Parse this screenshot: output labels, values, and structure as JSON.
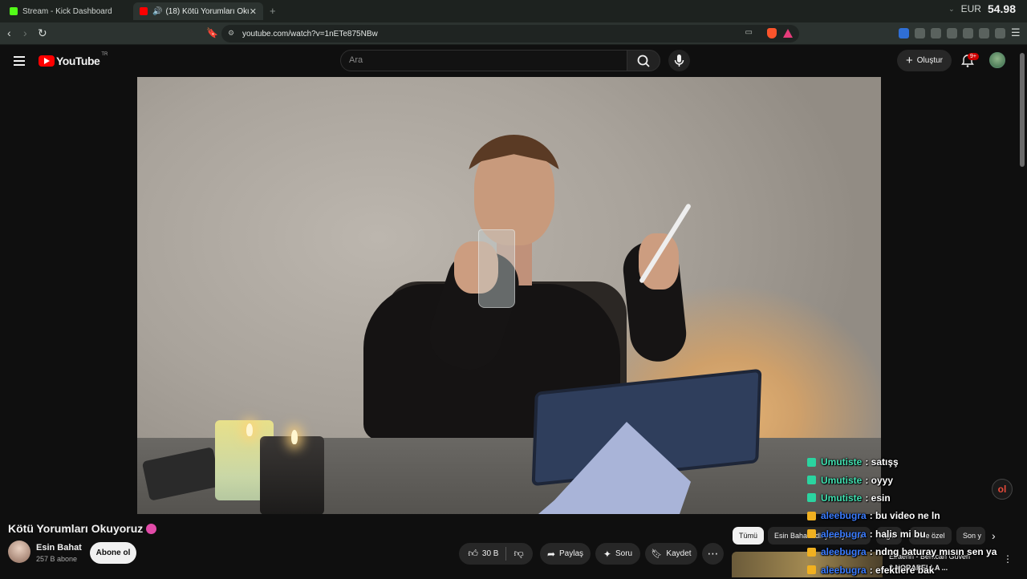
{
  "browser": {
    "tabs": [
      {
        "label": "Stream - Kick Dashboard",
        "favicon_color": "#53fc18"
      },
      {
        "label": "(18) Kötü Yorumları Okuyoruz",
        "favicon_color": "#ff0000"
      }
    ],
    "new_tab": "+",
    "currency": {
      "code": "EUR",
      "value": "54.98"
    },
    "url": "youtube.com/watch?v=1nETe875NBw"
  },
  "youtube": {
    "logo_text": "YouTube",
    "logo_region": "TR",
    "search_placeholder": "Ara",
    "create_label": "Oluştur",
    "notification_count": "9+"
  },
  "video": {
    "title": "Kötü Yorumları Okuyoruz",
    "channel_name": "Esin Bahat",
    "subscribers": "257 B abone",
    "subscribe_label": "Abone ol",
    "likes": "30 B",
    "share_label": "Paylaş",
    "ask_label": "Soru",
    "save_label": "Kaydet",
    "more": "⋯"
  },
  "chips": [
    {
      "label": "Tümü",
      "active": true
    },
    {
      "label": "Esin Bahat adlı yükleyiciden"
    },
    {
      "label": "İlgili"
    },
    {
      "label": "Size özel"
    },
    {
      "label": "Son y"
    }
  ],
  "recommendation": {
    "channel": "Eiraenn - Berkcan Güven",
    "title": "2 NORAPELLA ..."
  },
  "chat": [
    {
      "user": "Umutiste",
      "text": ": satışş",
      "color": "#41e0b0",
      "badge": "#2bd4a0"
    },
    {
      "user": "Umutiste",
      "text": ": oyyy",
      "color": "#41e0b0",
      "badge": "#2bd4a0"
    },
    {
      "user": "Umutiste",
      "text": ": esin",
      "color": "#41e0b0",
      "badge": "#2bd4a0"
    },
    {
      "user": "aleebugra",
      "text": ": bu video ne ln",
      "color": "#3b7cff",
      "badge": "#f0b020"
    },
    {
      "user": "aleebugra",
      "text": ": halis mi bu",
      "color": "#3b7cff",
      "badge": "#f0b020"
    },
    {
      "user": "aleebugra",
      "text": ": ndng baturay mısın sen ya",
      "color": "#3b7cff",
      "badge": "#f0b020"
    },
    {
      "user": "aleebugra",
      "text": ": efektlere bak",
      "color": "#3b7cff",
      "badge": "#f0b020"
    }
  ],
  "overlay_badge": "ol"
}
